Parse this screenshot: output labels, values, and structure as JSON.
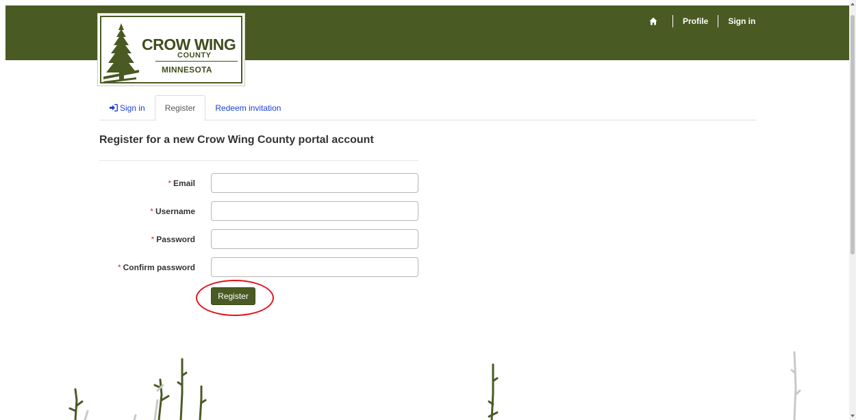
{
  "logo": {
    "line1": "CROW WING",
    "line2": "COUNTY",
    "line3": "MINNESOTA"
  },
  "topnav": {
    "home_icon": "home-icon",
    "profile": "Profile",
    "signin": "Sign in"
  },
  "tabs": [
    {
      "label": "Sign in",
      "icon": "sign-in-icon"
    },
    {
      "label": "Register"
    },
    {
      "label": "Redeem invitation"
    }
  ],
  "page": {
    "title": "Register for a new Crow Wing County portal account"
  },
  "form": {
    "required_marker": "*",
    "fields": [
      {
        "label": "Email",
        "value": ""
      },
      {
        "label": "Username",
        "value": ""
      },
      {
        "label": "Password",
        "value": ""
      },
      {
        "label": "Confirm password",
        "value": ""
      }
    ],
    "submit_label": "Register"
  },
  "colors": {
    "brand": "#4a5a23",
    "link": "#1a3fd6",
    "required": "#c0392b",
    "highlight": "#e3101a"
  }
}
